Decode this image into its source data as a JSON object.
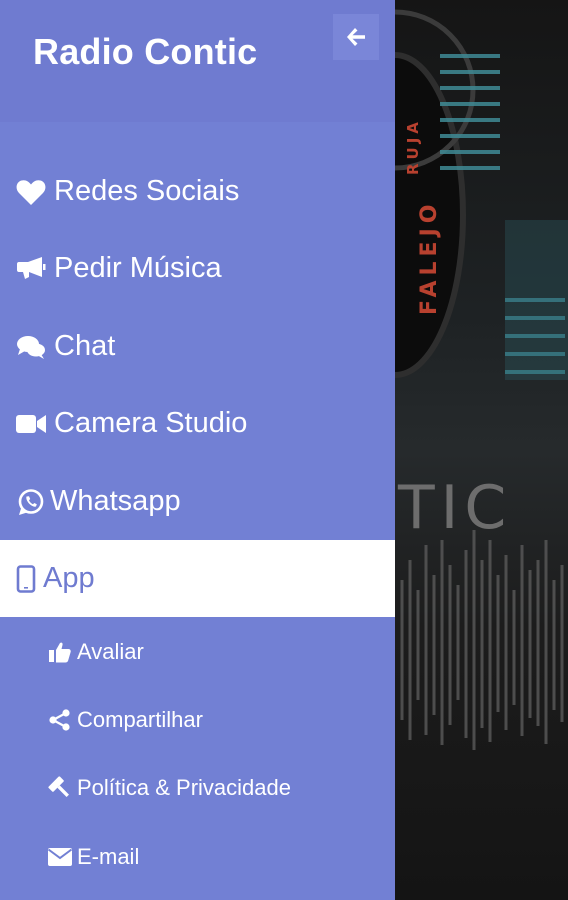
{
  "drawer": {
    "title": "Radio Contic",
    "back_icon": "arrow-left-icon"
  },
  "menu": {
    "items": [
      {
        "label": "Redes Sociais",
        "icon": "heart-icon"
      },
      {
        "label": "Pedir Música",
        "icon": "bullhorn-icon"
      },
      {
        "label": "Chat",
        "icon": "comments-icon"
      },
      {
        "label": "Camera Studio",
        "icon": "video-camera-icon"
      },
      {
        "label": "Whatsapp",
        "icon": "whatsapp-icon"
      },
      {
        "label": "App",
        "icon": "tablet-icon",
        "active": true
      }
    ],
    "sub_items": [
      {
        "label": "Avaliar",
        "icon": "thumbs-up-icon"
      },
      {
        "label": "Compartilhar",
        "icon": "share-icon"
      },
      {
        "label": "Política & Privacidade",
        "icon": "gavel-icon"
      },
      {
        "label": "E-mail",
        "icon": "envelope-icon"
      }
    ]
  },
  "background": {
    "logo_text_vertical": "FALEJO",
    "logo_text_vertical_2": "RUJA",
    "brand_text_partial": "TIC"
  },
  "colors": {
    "drawer": "#6f7bd0",
    "menu": "#7280d4",
    "active_bg": "#ffffff",
    "active_text": "#6f7bd0"
  }
}
